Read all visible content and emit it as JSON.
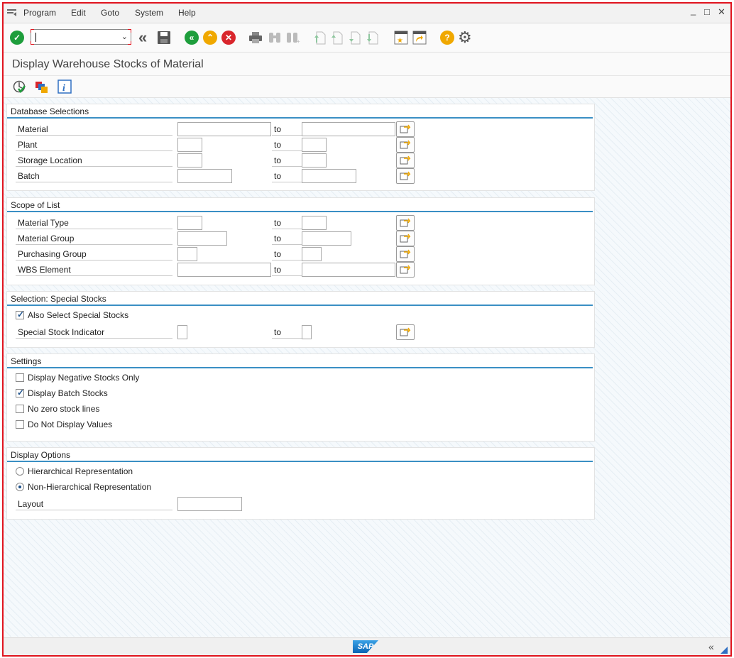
{
  "menu": {
    "items": [
      {
        "label": "Program"
      },
      {
        "label": "Edit"
      },
      {
        "label": "Goto"
      },
      {
        "label": "System"
      },
      {
        "label": "Help"
      }
    ]
  },
  "window": {
    "minimize": "_",
    "maximize": "□",
    "close": "✕"
  },
  "toolbar": {
    "command_field_value": "",
    "icons": [
      "check-icon",
      "command-field",
      "back-nav-icon",
      "save-icon",
      "back-icon",
      "exit-icon",
      "cancel-icon",
      "print-icon",
      "find-icon",
      "find-next-icon",
      "first-page-icon",
      "prev-page-icon",
      "next-page-icon",
      "last-page-icon",
      "new-session-icon",
      "shortcut-icon",
      "help-icon",
      "settings-gear-icon"
    ]
  },
  "page_title": "Display Warehouse Stocks of Material",
  "app_toolbar": {
    "icons": [
      "execute-icon",
      "get-variant-icon",
      "info-icon"
    ]
  },
  "to_label": "to",
  "groups": {
    "database_selections": {
      "title": "Database Selections",
      "rows": [
        {
          "label": "Material"
        },
        {
          "label": "Plant"
        },
        {
          "label": "Storage Location"
        },
        {
          "label": "Batch"
        }
      ]
    },
    "scope_of_list": {
      "title": "Scope of List",
      "rows": [
        {
          "label": "Material Type"
        },
        {
          "label": "Material Group"
        },
        {
          "label": "Purchasing Group"
        },
        {
          "label": "WBS Element"
        }
      ]
    },
    "special_stocks": {
      "title": "Selection: Special Stocks",
      "checkbox": {
        "label": "Also Select Special Stocks",
        "checked": true
      },
      "row": {
        "label": "Special Stock Indicator"
      }
    },
    "settings": {
      "title": "Settings",
      "checkboxes": [
        {
          "label": "Display Negative Stocks Only",
          "checked": false
        },
        {
          "label": "Display Batch Stocks",
          "checked": true
        },
        {
          "label": "No zero stock lines",
          "checked": false
        },
        {
          "label": "Do Not Display Values",
          "checked": false
        }
      ]
    },
    "display_options": {
      "title": "Display Options",
      "radios": [
        {
          "label": "Hierarchical Representation",
          "selected": false
        },
        {
          "label": "Non-Hierarchical Representation",
          "selected": true
        }
      ],
      "layout_label": "Layout"
    }
  },
  "status": {
    "logo": "SAP",
    "collapse": "«"
  },
  "colors": {
    "accent": "#3a8fc4",
    "frame": "#e0141e",
    "green": "#1e9e3c",
    "yellow": "#f0a800",
    "red": "#d9262c"
  }
}
